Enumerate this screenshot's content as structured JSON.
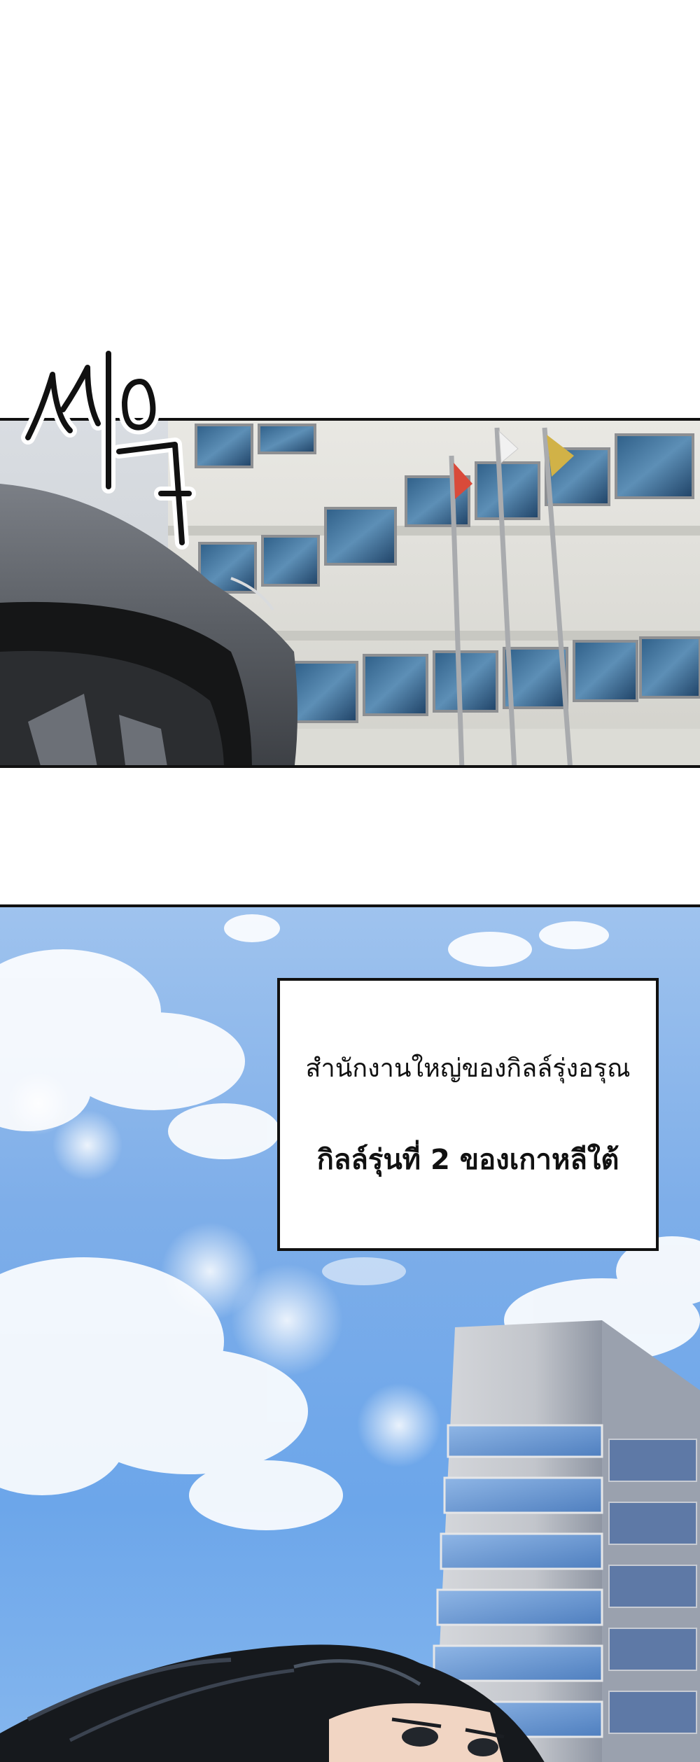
{
  "panel_1": {
    "sound_effect": "씨익"
  },
  "panel_2": {
    "caption": {
      "line_1": "สำนักงานใหญ่ของกิลล์รุ่งอรุณ",
      "line_2": "กิลล์รุ่นที่ 2 ของเกาหลีใต้"
    }
  }
}
